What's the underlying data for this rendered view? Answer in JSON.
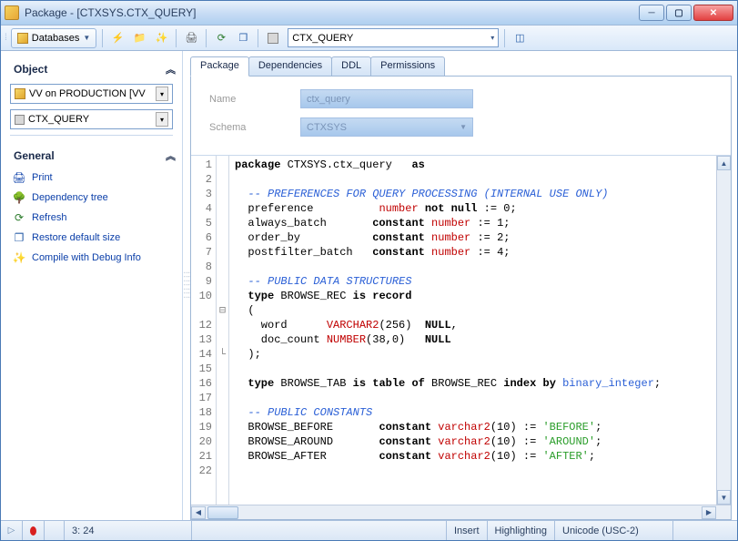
{
  "window": {
    "title": "Package - [CTXSYS.CTX_QUERY]"
  },
  "toolbar": {
    "databases_label": "Databases",
    "combo_value": "CTX_QUERY"
  },
  "sidebar": {
    "object_header": "Object",
    "connection_combo": "VV on PRODUCTION [VV",
    "object_combo": "CTX_QUERY",
    "general_header": "General",
    "links": [
      {
        "label": "Print"
      },
      {
        "label": "Dependency tree"
      },
      {
        "label": "Refresh"
      },
      {
        "label": "Restore default size"
      },
      {
        "label": "Compile with Debug Info"
      }
    ]
  },
  "tabs": [
    "Package",
    "Dependencies",
    "DDL",
    "Permissions"
  ],
  "form": {
    "name_label": "Name",
    "name_value": "ctx_query",
    "schema_label": "Schema",
    "schema_value": "CTXSYS"
  },
  "editor": {
    "lines": [
      {
        "n": 1,
        "html": "<span class='kw'>package</span> CTXSYS.ctx_query   <span class='kw'>as</span>"
      },
      {
        "n": 2,
        "html": ""
      },
      {
        "n": 3,
        "html": "  <span class='cm'>-- PREFERENCES FOR QUERY PROCESSING (INTERNAL USE ONLY)</span>"
      },
      {
        "n": 4,
        "html": "  preference          <span class='type'>number</span> <span class='kw'>not null</span> := 0;"
      },
      {
        "n": 5,
        "html": "  always_batch       <span class='kw'>constant</span> <span class='type'>number</span> := 1;"
      },
      {
        "n": 6,
        "html": "  order_by           <span class='kw'>constant</span> <span class='type'>number</span> := 2;"
      },
      {
        "n": 7,
        "html": "  postfilter_batch   <span class='kw'>constant</span> <span class='type'>number</span> := 4;"
      },
      {
        "n": 8,
        "html": ""
      },
      {
        "n": 9,
        "html": "  <span class='cm'>-- PUBLIC DATA STRUCTURES</span>"
      },
      {
        "n": 10,
        "html": "  <span class='kw'>type</span> BROWSE_REC <span class='kw'>is record</span>"
      },
      {
        "n": "",
        "fold": "⊟",
        "html": "  ("
      },
      {
        "n": 12,
        "html": "    word      <span class='type'>VARCHAR2</span>(256)  <span class='kw'>NULL</span>,"
      },
      {
        "n": 13,
        "html": "    doc_count <span class='type'>NUMBER</span>(38,0)   <span class='kw'>NULL</span>"
      },
      {
        "n": 14,
        "html": "  );"
      },
      {
        "n": 15,
        "html": ""
      },
      {
        "n": 16,
        "html": "  <span class='kw'>type</span> BROWSE_TAB <span class='kw'>is table of</span> BROWSE_REC <span class='kw'>index by</span> <span class='hl'>binary_integer</span>;"
      },
      {
        "n": 17,
        "html": ""
      },
      {
        "n": 18,
        "html": "  <span class='cm'>-- PUBLIC CONSTANTS</span>"
      },
      {
        "n": 19,
        "html": "  BROWSE_BEFORE       <span class='kw'>constant</span> <span class='type'>varchar2</span>(10) := <span class='str'>'BEFORE'</span>;"
      },
      {
        "n": 20,
        "html": "  BROWSE_AROUND       <span class='kw'>constant</span> <span class='type'>varchar2</span>(10) := <span class='str'>'AROUND'</span>;"
      },
      {
        "n": 21,
        "html": "  BROWSE_AFTER        <span class='kw'>constant</span> <span class='type'>varchar2</span>(10) := <span class='str'>'AFTER'</span>;"
      },
      {
        "n": 22,
        "html": ""
      }
    ]
  },
  "statusbar": {
    "cursor": "3:  24",
    "insert": "Insert",
    "highlight": "Highlighting",
    "encoding": "Unicode (USC-2)"
  }
}
